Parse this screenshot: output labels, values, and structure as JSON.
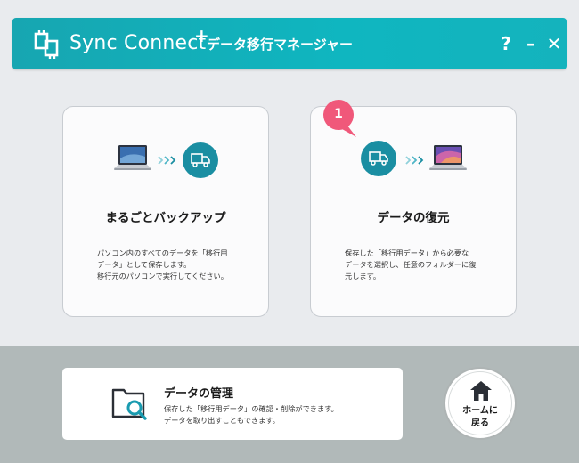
{
  "header": {
    "app_name": "Sync Connect",
    "plus_mark": "+",
    "subtitle": "データ移行マネージャー",
    "help_label": "?",
    "minimize_label": "–",
    "close_label": "✕",
    "logo_icon": "sync-connect-logo-icon"
  },
  "cards": {
    "backup": {
      "title": "まるごとバックアップ",
      "description": [
        "パソコン内のすべてのデータを「移行用",
        "データ」として保存します。",
        "移行元のパソコンで実行してください。"
      ],
      "icons": [
        "laptop-icon",
        "arrows-icon",
        "truck-icon"
      ]
    },
    "restore": {
      "badge": "1",
      "title": "データの復元",
      "description": [
        "保存した「移行用データ」から必要な",
        "データを選択し、任意のフォルダーに復",
        "元します。"
      ],
      "icons": [
        "truck-icon",
        "arrows-icon",
        "laptop-icon"
      ]
    }
  },
  "manage": {
    "title": "データの管理",
    "description": [
      "保存した「移行用データ」の確認・削除ができます。",
      "データを取り出すこともできます。"
    ],
    "icon": "folder-search-icon"
  },
  "home": {
    "label_line1": "ホームに",
    "label_line2": "戻る",
    "icon": "home-icon"
  },
  "colors": {
    "header": "#14b0bb",
    "truck_circle": "#1a8ea2",
    "badge": "#f0587a",
    "bottom_band": "#b1b9b9",
    "background": "#e9ebee"
  }
}
